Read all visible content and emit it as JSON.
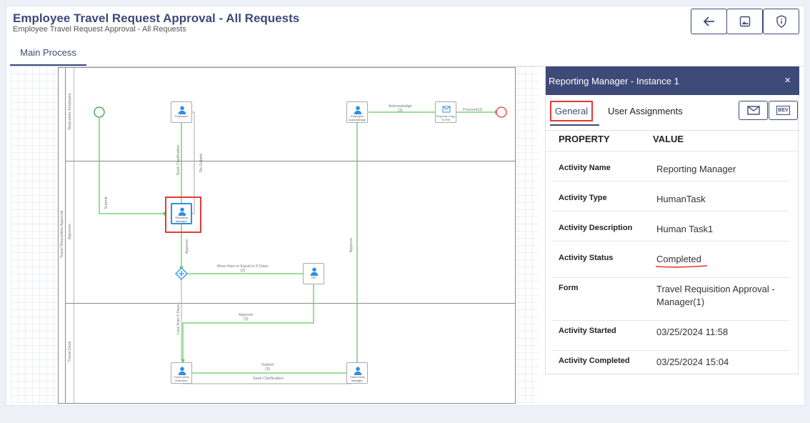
{
  "header": {
    "title": "Employee Travel Request Approval - All Requests",
    "subtitle": "Employee Travel Request Approval - All Requests"
  },
  "toolbar": {
    "icons": [
      "back-arrow-icon",
      "image-icon",
      "shield-info-icon"
    ]
  },
  "tabs": {
    "main_process": "Main Process"
  },
  "diagram": {
    "pool_label": "Travel Requisition Approval",
    "lanes": [
      "Requester Employee",
      "Approver",
      "Travel Desk"
    ],
    "tasks": {
      "employee": "Employee",
      "employee_acknowledge": "Employee Acknowledge",
      "emp_ack_copy": "Emp Ack Copy To RM",
      "reporting_manager": "Reporting Manager",
      "hr": "HR",
      "travel_desk_executive": "Travel Desk Executive",
      "travel_desk_manager": "Travel Desk Manager"
    },
    "flows": {
      "acknowledge": "Acknowledge",
      "acknowledge_count": "(3)",
      "proceed": "Proceed(3)",
      "seek_clarification": "Seek Clarification",
      "re_submit": "Re-Submit",
      "submit_left": "Submit",
      "more_days": "More than or Equal to 5 Days",
      "more_days_count": "(2)",
      "approve_hr": "Approve",
      "approve_hr_count": "(3)",
      "less_days": "Less than 5 Days",
      "approve_right": "Approve",
      "approve_rm": "Approve",
      "submit_bottom": "Submit",
      "submit_bottom_count": "(3)",
      "seek_clar_bottom": "Seek Clarification"
    },
    "colors": {
      "flow_green": "#5ccc5c",
      "start_green": "#2e9e45",
      "end_red": "#e53935",
      "highlight_red": "#e53935",
      "task_blue": "#2f8fe0"
    }
  },
  "panel": {
    "title": "Reporting Manager - Instance 1",
    "close": "×",
    "tabs": {
      "general": "General",
      "user_assignments": "User Assignments"
    },
    "buttons": {
      "mail_icon": "mail-icon",
      "bev_label": "BEV"
    },
    "table": {
      "headers": {
        "property": "PROPERTY",
        "value": "VALUE"
      },
      "rows": [
        {
          "k": "Activity Name",
          "v": "Reporting Manager"
        },
        {
          "k": "Activity Type",
          "v": "HumanTask"
        },
        {
          "k": "Activity Description",
          "v": "Human Task1"
        },
        {
          "k": "Activity Status",
          "v": "Completed"
        },
        {
          "k": "Form",
          "v": "Travel Requisition Approval - Manager(1)"
        },
        {
          "k": "Activity Started",
          "v": "03/25/2024 11:58"
        },
        {
          "k": "Activity Completed",
          "v": "03/25/2024 15:04"
        }
      ]
    }
  }
}
